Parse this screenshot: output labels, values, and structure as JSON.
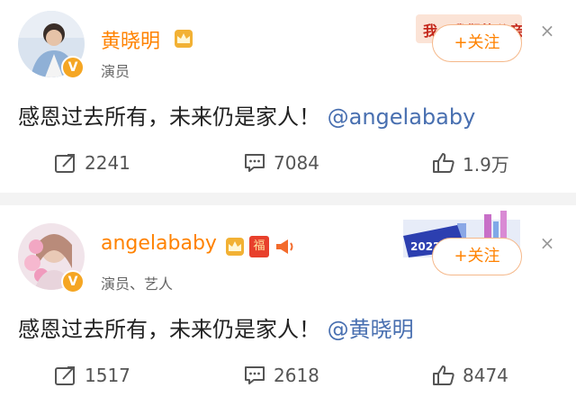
{
  "posts": [
    {
      "username": "黄晓明",
      "role": "演员",
      "content_text": "感恩过去所有，未来仍是家人！",
      "mention": "@angelababy",
      "banner_text": "我一我们的父亲",
      "follow_label": "+关注",
      "close_label": "×",
      "verified_mark": "V",
      "repost_count": "2241",
      "comment_count": "7084",
      "like_count": "1.9万"
    },
    {
      "username": "angelababy",
      "role": "演员、艺人",
      "content_text": "感恩过去所有，未来仍是家人！",
      "mention": "@黄晓明",
      "banner_text": "2022",
      "fu_badge": "福",
      "follow_label": "+关注",
      "close_label": "×",
      "verified_mark": "V",
      "repost_count": "1517",
      "comment_count": "2618",
      "like_count": "8474"
    }
  ],
  "colors": {
    "username": "#ff8200",
    "mention": "#486fb0",
    "verified_badge": "#f5a623",
    "divider": "#f3f3f3"
  },
  "icons": [
    "repost-icon",
    "comment-icon",
    "like-icon",
    "crown-icon",
    "horn-icon",
    "close-icon"
  ]
}
